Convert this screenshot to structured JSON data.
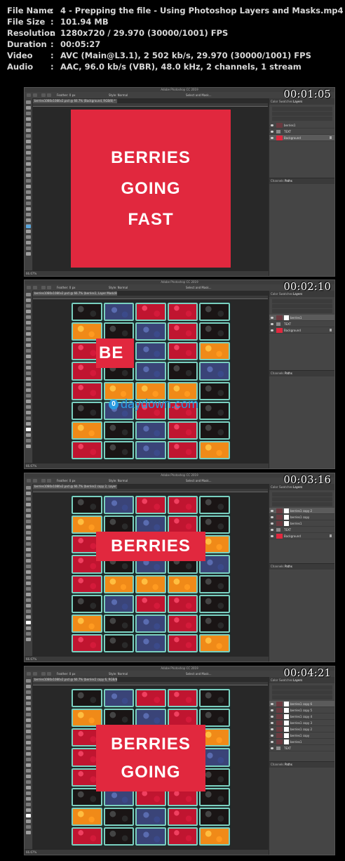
{
  "meta_info": [
    {
      "key": "File Name",
      "value": "4 - Prepping the file - Using Photoshop Layers and Masks.mp4"
    },
    {
      "key": "File Size",
      "value": "101.94 MB"
    },
    {
      "key": "Resolution",
      "value": "1280x720 / 29.970 (30000/1001) FPS"
    },
    {
      "key": "Duration",
      "value": "00:05:27"
    },
    {
      "key": "Video",
      "value": "AVC (Main@L3.1), 2 502 kb/s, 29.970 (30000/1001) FPS"
    },
    {
      "key": "Audio",
      "value": "AAC, 96.0 kb/s (VBR), 48.0 kHz, 2 channels, 1 stream"
    }
  ],
  "separator": ":",
  "app_title": "Adobe Photoshop CC 2019",
  "options": {
    "feather": "Feather: 0 px",
    "style": "Style: Normal",
    "select_mask": "Select and Mask..."
  },
  "panel_tabs": {
    "color": "Color",
    "swatches": "Swatches",
    "layers": "Layers",
    "channels": "Channels",
    "paths": "Paths"
  },
  "frames": [
    {
      "timestamp": "00:01:05",
      "doc_tab": "berries1080x1080v2.psd @ 66.7% (Background, RGB/8) *",
      "zoom": "66.67%",
      "canvas_text": [
        "BERRIES",
        "GOING",
        "FAST"
      ],
      "layers": [
        {
          "name": "berries1",
          "thumb": "photo"
        },
        {
          "name": "TEXT",
          "thumb": "folder"
        },
        {
          "name": "Background",
          "thumb": "red",
          "selected": true
        }
      ]
    },
    {
      "timestamp": "00:02:10",
      "doc_tab": "berries1080x1080v2.psd @ 66.7% (berries1, Layer Mask/8) *",
      "zoom": "66.67%",
      "canvas_text": [
        "BE"
      ],
      "watermark": "0daydown.com",
      "layers": [
        {
          "name": "berries1",
          "thumb": "photo",
          "mask": true,
          "selected": true
        },
        {
          "name": "TEXT",
          "thumb": "folder"
        },
        {
          "name": "Background",
          "thumb": "red"
        }
      ]
    },
    {
      "timestamp": "00:03:16",
      "doc_tab": "berries1080x1080v2.psd @ 66.7% (berries1 copy 2, Layer Mask/8) *",
      "zoom": "66.67%",
      "canvas_text": [
        "BERRIES"
      ],
      "layers": [
        {
          "name": "berries1 copy 2",
          "thumb": "photo",
          "mask": true,
          "selected": true
        },
        {
          "name": "berries1 copy",
          "thumb": "photo",
          "mask": true
        },
        {
          "name": "berries1",
          "thumb": "photo",
          "mask": true
        },
        {
          "name": "TEXT",
          "thumb": "folder"
        },
        {
          "name": "Background",
          "thumb": "red"
        }
      ]
    },
    {
      "timestamp": "00:04:21",
      "doc_tab": "berries1080x1080v2.psd @ 66.7% (berries1 copy 6, RGB/8) *",
      "zoom": "66.67%",
      "canvas_text": [
        "BERRIES",
        "GOING"
      ],
      "layers": [
        {
          "name": "berries1 copy 6",
          "thumb": "photo",
          "mask": true,
          "selected": true
        },
        {
          "name": "berries1 copy 5",
          "thumb": "photo",
          "mask": true
        },
        {
          "name": "berries1 copy 4",
          "thumb": "photo",
          "mask": true
        },
        {
          "name": "berries1 copy 3",
          "thumb": "photo",
          "mask": true
        },
        {
          "name": "berries1 copy 2",
          "thumb": "photo",
          "mask": true
        },
        {
          "name": "berries1 copy",
          "thumb": "photo",
          "mask": true
        },
        {
          "name": "berries1",
          "thumb": "photo",
          "mask": true
        },
        {
          "name": "TEXT",
          "thumb": "folder"
        }
      ]
    }
  ]
}
